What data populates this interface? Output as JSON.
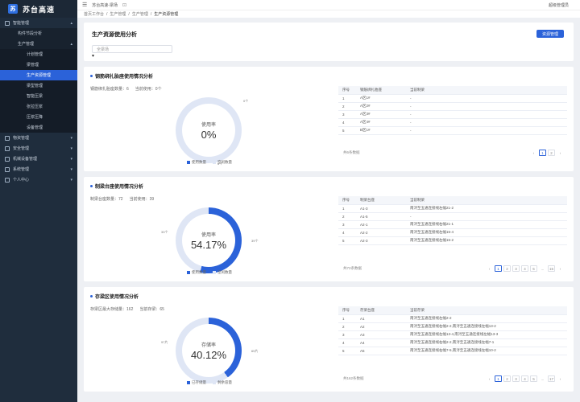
{
  "brand": {
    "title": "苏台高速"
  },
  "sidebar": {
    "items": [
      {
        "label": "智能管理",
        "level": 0,
        "expanded": true
      },
      {
        "label": "构件节段分析",
        "level": 1
      },
      {
        "label": "生产管理",
        "level": 1,
        "expanded": true
      },
      {
        "label": "计划管理",
        "level": 2
      },
      {
        "label": "梁管理",
        "level": 2
      },
      {
        "label": "生产资源管理",
        "level": 2,
        "active": true
      },
      {
        "label": "梁型管理",
        "level": 2
      },
      {
        "label": "智能压梁",
        "level": 2
      },
      {
        "label": "张拉压浆",
        "level": 2
      },
      {
        "label": "压浆压降",
        "level": 2
      },
      {
        "label": "设备管理",
        "level": 2
      },
      {
        "label": "物资管理",
        "level": 0
      },
      {
        "label": "安全管理",
        "level": 0
      },
      {
        "label": "机械设备管理",
        "level": 0
      },
      {
        "label": "系统管理",
        "level": 0
      },
      {
        "label": "个人中心",
        "level": 0
      }
    ]
  },
  "topbar": {
    "project": "苏台高速-梁场",
    "user": "超级管理员"
  },
  "breadcrumb": [
    "首页工作台",
    "生产管理",
    "生产管理",
    "生产资源管理"
  ],
  "header": {
    "title": "生产资源使用分析",
    "select_value": "全梁场",
    "button": "资源管理"
  },
  "colors": {
    "accent": "#2b62d9",
    "free": "#dfe6f5"
  },
  "sections": [
    {
      "title": "钢筋绑扎胎座使用情况分析",
      "stats": [
        "钢筋绑扎胎座数量：6",
        "当前使用：0个"
      ],
      "donut": {
        "label": "使用率",
        "percent_text": "0%",
        "fraction": 0,
        "callout_a": "0个",
        "callout_b": "6个"
      },
      "legend": [
        "使用数量",
        "空闲数量"
      ],
      "table": {
        "headers": [
          "序号",
          "钢筋绑扎胎座",
          "当前制梁"
        ],
        "rows": [
          [
            "1",
            "A区1#",
            "-"
          ],
          [
            "2",
            "A区2#",
            "-"
          ],
          [
            "3",
            "A区3#",
            "-"
          ],
          [
            "4",
            "A区4#",
            "-"
          ],
          [
            "5",
            "B区1#",
            "-"
          ]
        ]
      },
      "pager": {
        "total": "共6条数据",
        "pages": [
          "1",
          "2"
        ],
        "current": "1"
      }
    },
    {
      "title": "制梁台座使用情况分析",
      "stats": [
        "制梁台座数量：72",
        "当前使用：39"
      ],
      "donut": {
        "label": "使用率",
        "percent_text": "54.17%",
        "fraction": 0.5417,
        "callout_a": "39个",
        "callout_b": "33个"
      },
      "legend": [
        "使用数量",
        "空闲数量"
      ],
      "table": {
        "headers": [
          "序号",
          "制梁台座",
          "当前制梁"
        ],
        "rows": [
          [
            "1",
            "A1-3",
            "南浔至五通连接线左幅21-2"
          ],
          [
            "2",
            "A1-5",
            "-"
          ],
          [
            "3",
            "A2-1",
            "南浔至五通连接线右幅21-1"
          ],
          [
            "4",
            "A2-2",
            "南浔至五通连接线左幅15-4"
          ],
          [
            "5",
            "A2-3",
            "南浔至五通连接线左幅15-2"
          ]
        ]
      },
      "pager": {
        "total": "共72条数据",
        "pages": [
          "1",
          "2",
          "3",
          "4",
          "5",
          "...",
          "15"
        ],
        "current": "1"
      }
    },
    {
      "title": "存梁区使用情况分析",
      "stats": [
        "存梁区最大存储量：162",
        "当前存梁：65"
      ],
      "donut": {
        "label": "存储率",
        "percent_text": "40.12%",
        "fraction": 0.4012,
        "callout_a": "65片",
        "callout_b": "97片"
      },
      "legend": [
        "已存储量",
        "剩余容量"
      ],
      "table": {
        "headers": [
          "序号",
          "存梁台座",
          "当前存梁"
        ],
        "rows": [
          [
            "1",
            "A1",
            "南浔至五通连接线左幅2-2"
          ],
          [
            "2",
            "A2",
            "南浔至五通连接线右幅2-2,南浔至五通连接线左幅13-2"
          ],
          [
            "3",
            "A3",
            "南浔至五通连接线左幅13-4,南浔至五通连接线左幅13-3"
          ],
          [
            "4",
            "A4",
            "南浔至五通连接线右幅2-2,南浔至五通连接线左幅7-1"
          ],
          [
            "5",
            "A5",
            "南浔至五通连接线右幅7-5,南浔至五通连接线左幅10-2"
          ]
        ]
      },
      "pager": {
        "total": "共162条数据",
        "pages": [
          "1",
          "2",
          "3",
          "4",
          "5",
          "...",
          "17"
        ],
        "current": "1"
      }
    }
  ]
}
